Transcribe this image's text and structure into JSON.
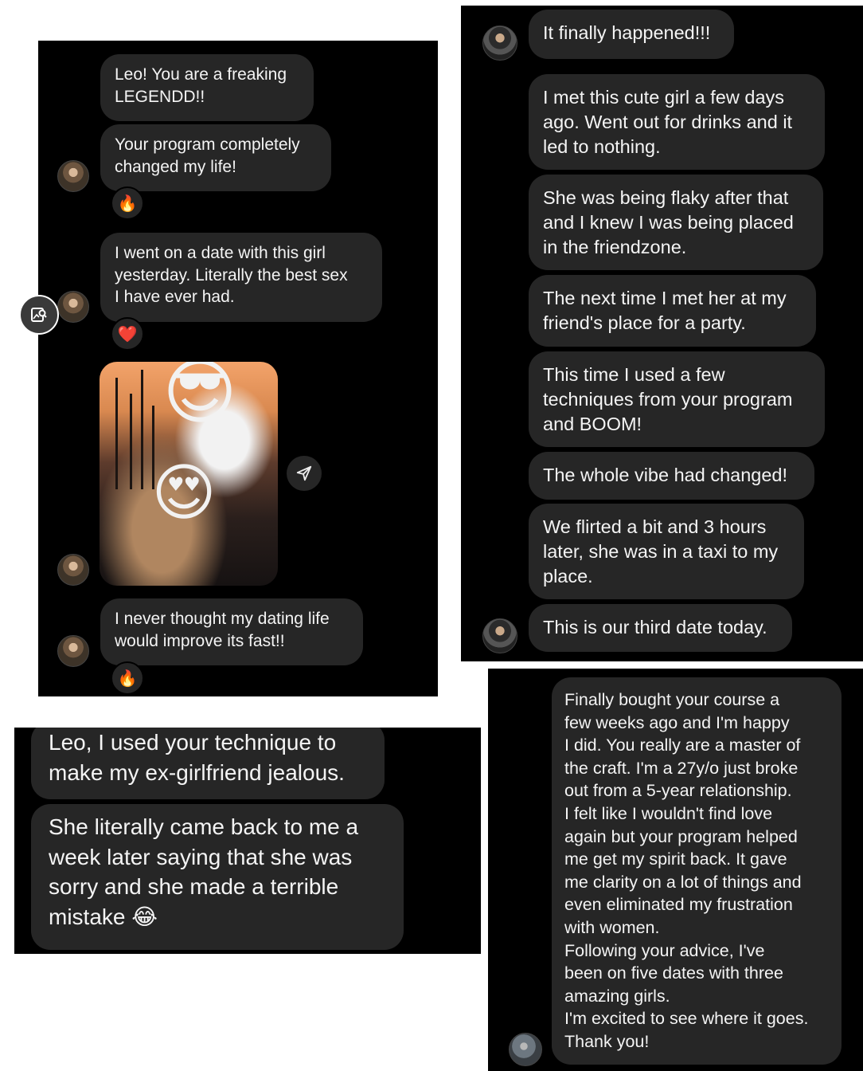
{
  "panel_1": {
    "messages": [
      "Leo! You are a freaking\nLEGENDD!!",
      "Your program completely\nchanged my life!",
      "I went on a date with this girl\nyesterday. Literally the best sex\nI have ever had.",
      "I never thought my dating life\nwould improve its fast!!"
    ],
    "reactions": [
      "🔥",
      "❤️",
      "🔥"
    ],
    "photo_emojis": [
      "😎",
      "😍"
    ]
  },
  "panel_2": {
    "messages": [
      "It finally happened!!!",
      "I met this cute girl a few days\nago. Went out for drinks and it\nled to nothing.",
      "She was being flaky after that\nand I knew I was being placed\nin the friendzone.",
      "The next time I met her at my\nfriend's place for a party.",
      "This time I used a few\ntechniques from your program\nand BOOM!",
      "The whole vibe had changed!",
      "We flirted a bit and 3 hours\nlater, she was in a taxi to my\nplace.",
      "This is our third date today."
    ]
  },
  "panel_3": {
    "messages": [
      "Leo, I used your technique to\nmake my ex-girlfriend jealous.",
      "She literally came back to me a\nweek later saying that she was\nsorry and she made a terrible\nmistake 😂"
    ]
  },
  "panel_4": {
    "messages": [
      "Finally bought your course a\nfew weeks ago and I'm happy\nI did. You really are a master of\nthe craft. I'm a 27y/o just broke\nout from a 5-year relationship.\nI felt like I wouldn't find love\nagain but your program helped\nme get my spirit back. It gave\nme clarity on a lot of things and\neven eliminated my frustration\nwith women.\nFollowing your advice, I've\nbeen on five dates with three\namazing girls.\nI'm excited to see where it goes.\nThank you!"
    ]
  },
  "icons": {
    "share": "paper-plane-icon",
    "visual_search": "image-search-icon",
    "avatar": "user-avatar"
  },
  "colors": {
    "panel_bg": "#000000",
    "bubble_bg": "#262626",
    "text": "#f4f4f4"
  }
}
